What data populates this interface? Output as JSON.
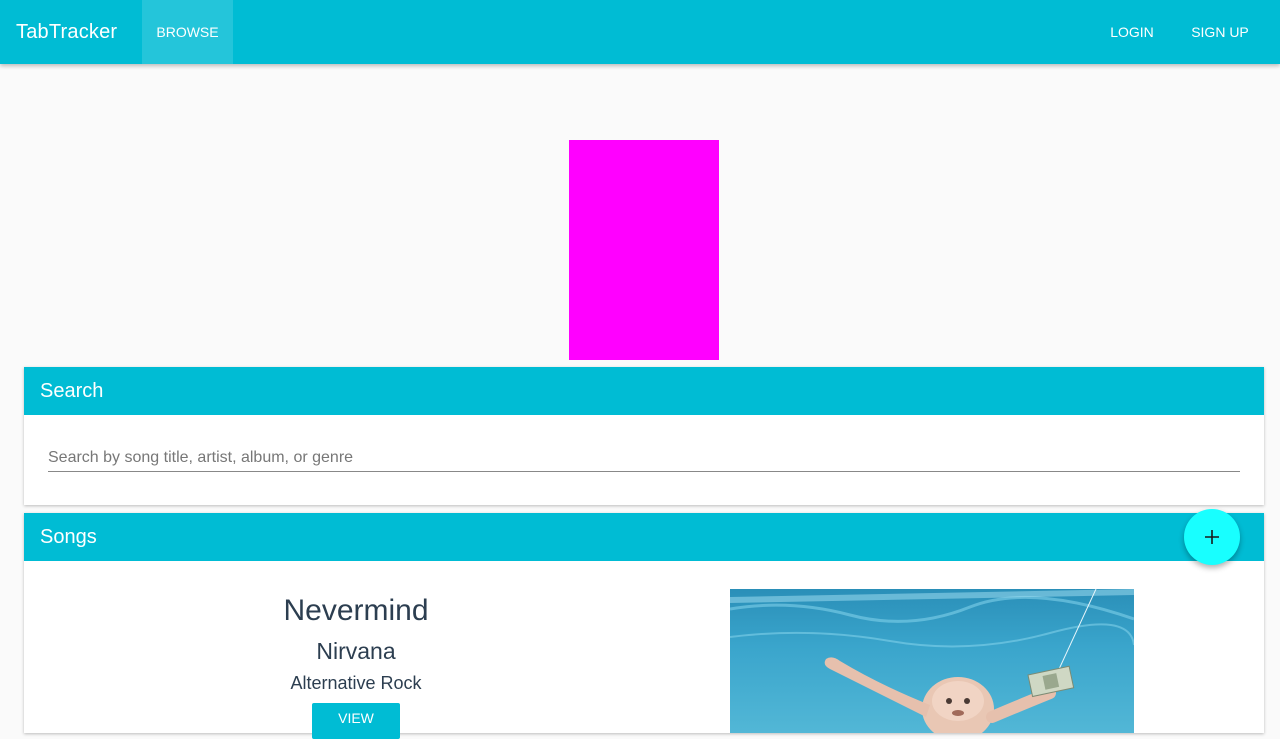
{
  "app": {
    "title": "TabTracker"
  },
  "nav": {
    "browse_label": "BROWSE",
    "login_label": "LOGIN",
    "signup_label": "SIGN UP"
  },
  "search": {
    "header": "Search",
    "placeholder": "Search by song title, artist, album, or genre",
    "value": ""
  },
  "songs": {
    "header": "Songs",
    "add_icon": "plus-icon",
    "items": [
      {
        "title": "Nevermind",
        "artist": "Nirvana",
        "genre": "Alternative Rock",
        "view_label": "VIEW"
      }
    ]
  },
  "colors": {
    "primary": "#00bcd4",
    "accent": "#18ffff",
    "placeholder_block": "#ff00ff",
    "text_dark": "#2c3e50"
  }
}
